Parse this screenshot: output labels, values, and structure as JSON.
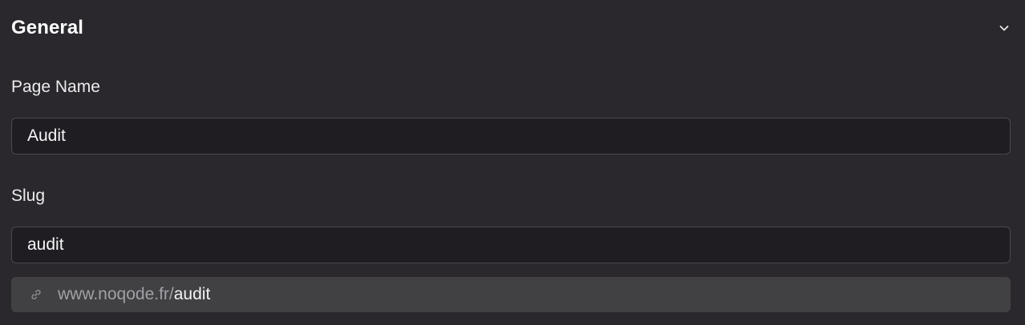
{
  "section": {
    "title": "General",
    "toggle_icon": "chevron-down-icon"
  },
  "fields": {
    "page_name": {
      "label": "Page Name",
      "value": "Audit"
    },
    "slug": {
      "label": "Slug",
      "value": "audit"
    }
  },
  "url_preview": {
    "icon": "link-icon",
    "base": "www.noqode.fr/",
    "slug": "audit"
  },
  "colors": {
    "panel_bg": "#2a282c",
    "input_bg": "#1f1d21",
    "input_border": "#4a484e",
    "url_bar_bg": "#414043",
    "url_base_text": "#a2a0a6",
    "primary_text": "#f2f2f4"
  }
}
